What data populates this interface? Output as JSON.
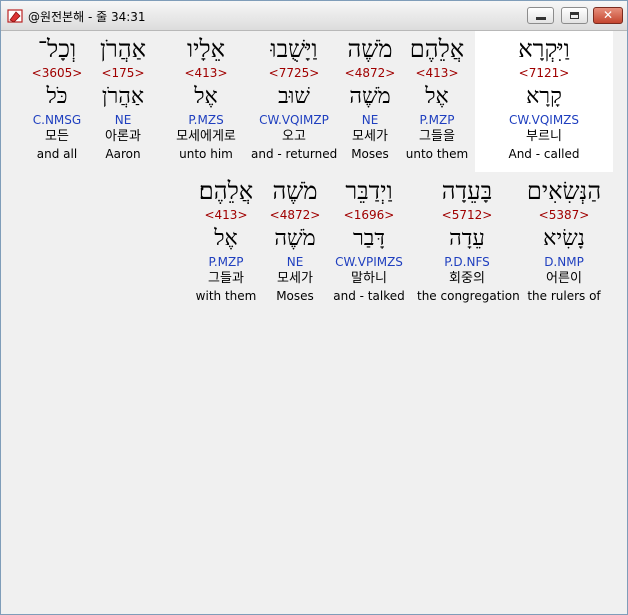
{
  "window": {
    "title": "@원전본해 - 줄 34:31",
    "minimize_glyph": "",
    "close_glyph": "✕"
  },
  "row1": [
    {
      "hebrew": "וַיִּקְרָא",
      "strong": "<7121>",
      "lemma": "קָרָא",
      "morph": "CW.VQIMZS",
      "korean": "부르니",
      "english": "And - called",
      "highlighted": true
    },
    {
      "hebrew": "אֲלֵהֶם",
      "strong": "<413>",
      "lemma": "אֶל",
      "morph": "P.MZP",
      "korean": "그들을",
      "english": "unto them"
    },
    {
      "hebrew": "מֹשֶׁה",
      "strong": "<4872>",
      "lemma": "מֹשֶׁה",
      "morph": "NE",
      "korean": "모세가",
      "english": "Moses"
    },
    {
      "hebrew": "וַיָּשֻׁבוּ",
      "strong": "<7725>",
      "lemma": "שׁוּב",
      "morph": "CW.VQIMZP",
      "korean": "오고",
      "english": "and - returned"
    },
    {
      "hebrew": "אֵלָיו",
      "strong": "<413>",
      "lemma": "אֶל",
      "morph": "P.MZS",
      "korean": "모세에게로",
      "english": "unto him"
    },
    {
      "hebrew": "אַהֲרֹן",
      "strong": "<175>",
      "lemma": "אַהֲרֹן",
      "morph": "NE",
      "korean": "아론과",
      "english": "Aaron"
    },
    {
      "hebrew": "וְכָל־",
      "strong": "<3605>",
      "lemma": "כֹּל",
      "morph": "C.NMSG",
      "korean": "모든",
      "english": "and all"
    }
  ],
  "row2": [
    {
      "hebrew": "הַנְּשִׂאִים",
      "strong": "<5387>",
      "lemma": "נָשִׂיא",
      "morph": "D.NMP",
      "korean": "어른이",
      "english": "the rulers of"
    },
    {
      "hebrew": "בָּעֵדָה",
      "strong": "<5712>",
      "lemma": "עֵדָה",
      "morph": "P.D.NFS",
      "korean": "회중의",
      "english": "the congregation"
    },
    {
      "hebrew": "וַיְדַבֵּר",
      "strong": "<1696>",
      "lemma": "דָּבַר",
      "morph": "CW.VPIMZS",
      "korean": "말하니",
      "english": "and - talked"
    },
    {
      "hebrew": "מֹשֶׁה",
      "strong": "<4872>",
      "lemma": "מֹשֶׁה",
      "morph": "NE",
      "korean": "모세가",
      "english": "Moses"
    },
    {
      "hebrew": "אֲלֵהֶם׃",
      "strong": "<413>",
      "lemma": "אֶל",
      "morph": "P.MZP",
      "korean": "그들과",
      "english": "with them"
    }
  ]
}
